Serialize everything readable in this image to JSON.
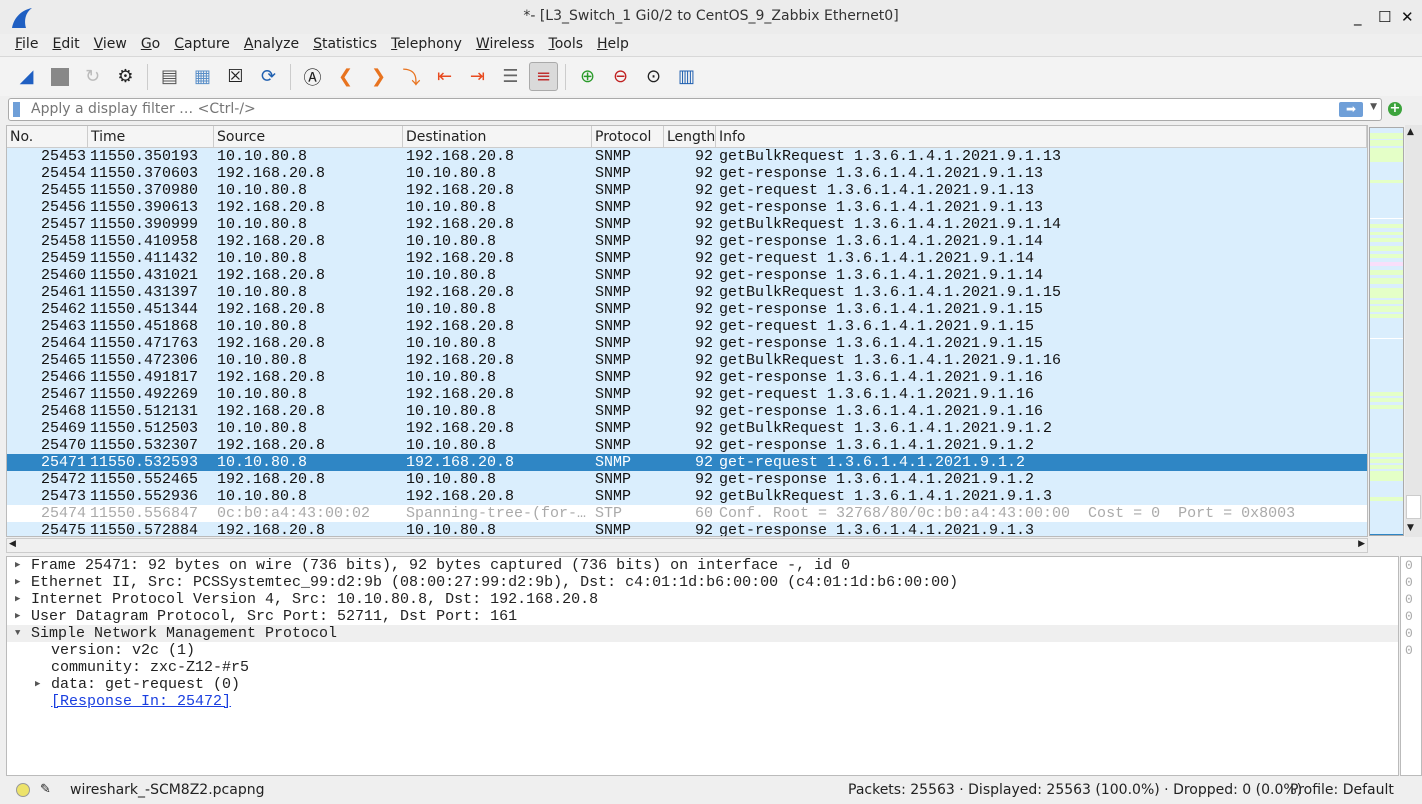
{
  "window": {
    "title": "*- [L3_Switch_1 Gi0/2 to CentOS_9_Zabbix Ethernet0]",
    "minimize": "_",
    "maximize": "☐",
    "close": "✕"
  },
  "menu": [
    "File",
    "Edit",
    "View",
    "Go",
    "Capture",
    "Analyze",
    "Statistics",
    "Telephony",
    "Wireless",
    "Tools",
    "Help"
  ],
  "toolbar": [
    "start-capture",
    "stop-capture",
    "restart-capture",
    "capture-options",
    "open-file",
    "save-file",
    "close-file",
    "reload-file",
    "find-packet",
    "go-back",
    "go-forward",
    "go-to-packet",
    "go-first",
    "go-last",
    "auto-scroll",
    "colorize",
    "zoom-in",
    "zoom-out",
    "normal-size",
    "resize-columns"
  ],
  "filter": {
    "placeholder": "Apply a display filter … <Ctrl-/>",
    "value": ""
  },
  "columns": [
    "No.",
    "Time",
    "Source",
    "Destination",
    "Protocol",
    "Length",
    "Info"
  ],
  "packets": [
    [
      "25453",
      "11550.350193",
      "10.10.80.8",
      "192.168.20.8",
      "SNMP",
      "92",
      "getBulkRequest 1.3.6.1.4.1.2021.9.1.13"
    ],
    [
      "25454",
      "11550.370603",
      "192.168.20.8",
      "10.10.80.8",
      "SNMP",
      "92",
      "get-response 1.3.6.1.4.1.2021.9.1.13"
    ],
    [
      "25455",
      "11550.370980",
      "10.10.80.8",
      "192.168.20.8",
      "SNMP",
      "92",
      "get-request 1.3.6.1.4.1.2021.9.1.13"
    ],
    [
      "25456",
      "11550.390613",
      "192.168.20.8",
      "10.10.80.8",
      "SNMP",
      "92",
      "get-response 1.3.6.1.4.1.2021.9.1.13"
    ],
    [
      "25457",
      "11550.390999",
      "10.10.80.8",
      "192.168.20.8",
      "SNMP",
      "92",
      "getBulkRequest 1.3.6.1.4.1.2021.9.1.14"
    ],
    [
      "25458",
      "11550.410958",
      "192.168.20.8",
      "10.10.80.8",
      "SNMP",
      "92",
      "get-response 1.3.6.1.4.1.2021.9.1.14"
    ],
    [
      "25459",
      "11550.411432",
      "10.10.80.8",
      "192.168.20.8",
      "SNMP",
      "92",
      "get-request 1.3.6.1.4.1.2021.9.1.14"
    ],
    [
      "25460",
      "11550.431021",
      "192.168.20.8",
      "10.10.80.8",
      "SNMP",
      "92",
      "get-response 1.3.6.1.4.1.2021.9.1.14"
    ],
    [
      "25461",
      "11550.431397",
      "10.10.80.8",
      "192.168.20.8",
      "SNMP",
      "92",
      "getBulkRequest 1.3.6.1.4.1.2021.9.1.15"
    ],
    [
      "25462",
      "11550.451344",
      "192.168.20.8",
      "10.10.80.8",
      "SNMP",
      "92",
      "get-response 1.3.6.1.4.1.2021.9.1.15"
    ],
    [
      "25463",
      "11550.451868",
      "10.10.80.8",
      "192.168.20.8",
      "SNMP",
      "92",
      "get-request 1.3.6.1.4.1.2021.9.1.15"
    ],
    [
      "25464",
      "11550.471763",
      "192.168.20.8",
      "10.10.80.8",
      "SNMP",
      "92",
      "get-response 1.3.6.1.4.1.2021.9.1.15"
    ],
    [
      "25465",
      "11550.472306",
      "10.10.80.8",
      "192.168.20.8",
      "SNMP",
      "92",
      "getBulkRequest 1.3.6.1.4.1.2021.9.1.16"
    ],
    [
      "25466",
      "11550.491817",
      "192.168.20.8",
      "10.10.80.8",
      "SNMP",
      "92",
      "get-response 1.3.6.1.4.1.2021.9.1.16"
    ],
    [
      "25467",
      "11550.492269",
      "10.10.80.8",
      "192.168.20.8",
      "SNMP",
      "92",
      "get-request 1.3.6.1.4.1.2021.9.1.16"
    ],
    [
      "25468",
      "11550.512131",
      "192.168.20.8",
      "10.10.80.8",
      "SNMP",
      "92",
      "get-response 1.3.6.1.4.1.2021.9.1.16"
    ],
    [
      "25469",
      "11550.512503",
      "10.10.80.8",
      "192.168.20.8",
      "SNMP",
      "92",
      "getBulkRequest 1.3.6.1.4.1.2021.9.1.2"
    ],
    [
      "25470",
      "11550.532307",
      "192.168.20.8",
      "10.10.80.8",
      "SNMP",
      "92",
      "get-response 1.3.6.1.4.1.2021.9.1.2"
    ],
    [
      "25471",
      "11550.532593",
      "10.10.80.8",
      "192.168.20.8",
      "SNMP",
      "92",
      "get-request 1.3.6.1.4.1.2021.9.1.2"
    ],
    [
      "25472",
      "11550.552465",
      "192.168.20.8",
      "10.10.80.8",
      "SNMP",
      "92",
      "get-response 1.3.6.1.4.1.2021.9.1.2"
    ],
    [
      "25473",
      "11550.552936",
      "10.10.80.8",
      "192.168.20.8",
      "SNMP",
      "92",
      "getBulkRequest 1.3.6.1.4.1.2021.9.1.3"
    ],
    [
      "25474",
      "11550.556847",
      "0c:b0:a4:43:00:02",
      "Spanning-tree-(for-…",
      "STP",
      "60",
      "Conf. Root = 32768/80/0c:b0:a4:43:00:00  Cost = 0  Port = 0x8003"
    ],
    [
      "25475",
      "11550.572884",
      "192.168.20.8",
      "10.10.80.8",
      "SNMP",
      "92",
      "get-response 1.3.6.1.4.1.2021.9.1.3"
    ]
  ],
  "selected_packet": "25471",
  "colors": {
    "snmp_row": "#daeefd",
    "selected_row": "#2f86c5",
    "stp_row": "#ffffff"
  },
  "details": [
    {
      "text": "Frame 25471: 92 bytes on wire (736 bits), 92 bytes captured (736 bits) on interface -, id 0",
      "level": 0,
      "state": "collapsed"
    },
    {
      "text": "Ethernet II, Src: PCSSystemtec_99:d2:9b (08:00:27:99:d2:9b), Dst: c4:01:1d:b6:00:00 (c4:01:1d:b6:00:00)",
      "level": 0,
      "state": "collapsed"
    },
    {
      "text": "Internet Protocol Version 4, Src: 10.10.80.8, Dst: 192.168.20.8",
      "level": 0,
      "state": "collapsed"
    },
    {
      "text": "User Datagram Protocol, Src Port: 52711, Dst Port: 161",
      "level": 0,
      "state": "collapsed"
    },
    {
      "text": "Simple Network Management Protocol",
      "level": 0,
      "state": "expanded"
    },
    {
      "text": "version: v2c (1)",
      "level": 1,
      "state": "leaf"
    },
    {
      "text": "community: zxc-Z12-#r5",
      "level": 1,
      "state": "leaf"
    },
    {
      "text": "data: get-request (0)",
      "level": 1,
      "state": "collapsed"
    },
    {
      "text": "[Response In: 25472]",
      "level": 1,
      "state": "link"
    }
  ],
  "status": {
    "file": "wireshark_-SCM8Z2.pcapng",
    "stats": "Packets: 25563 · Displayed: 25563 (100.0%) · Dropped: 0 (0.0%)",
    "profile": "Profile: Default"
  }
}
